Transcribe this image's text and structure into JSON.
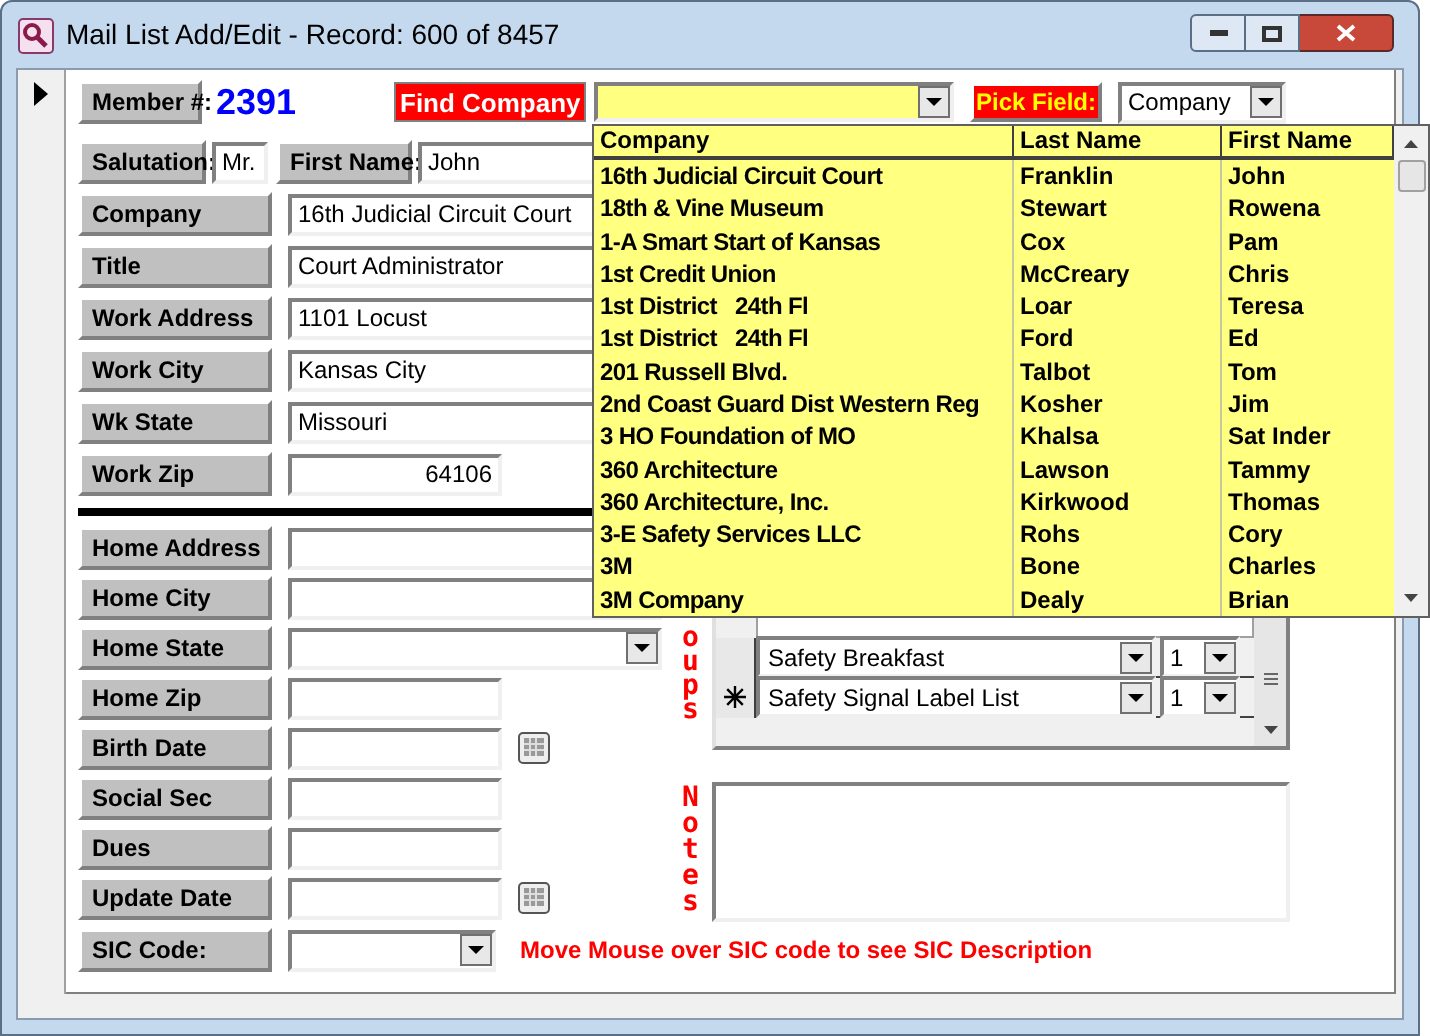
{
  "window": {
    "title": "Mail List Add/Edit - Record: 600 of 8457"
  },
  "member": {
    "label": "Member #:",
    "value": "2391"
  },
  "find_company": {
    "button": "Find Company"
  },
  "pick_field": {
    "label": "Pick Field:",
    "value": "Company"
  },
  "salutation": {
    "label": "Salutation:",
    "value": "Mr."
  },
  "first_name": {
    "label": "First Name:",
    "value": "John"
  },
  "work_fields": [
    {
      "label": "Company",
      "value": "16th Judicial Circuit Court",
      "kind": "text"
    },
    {
      "label": "Title",
      "value": "Court Administrator",
      "kind": "text"
    },
    {
      "label": "Work Address",
      "value": "1101 Locust",
      "kind": "text"
    },
    {
      "label": "Work City",
      "value": "Kansas City",
      "kind": "text"
    },
    {
      "label": "Wk State",
      "value": "Missouri",
      "kind": "text"
    },
    {
      "label": "Work Zip",
      "value": "64106",
      "kind": "number"
    }
  ],
  "home_fields": [
    {
      "label": "Home Address",
      "kind": "text"
    },
    {
      "label": "Home City",
      "kind": "text"
    },
    {
      "label": "Home State",
      "kind": "combo"
    },
    {
      "label": "Home Zip",
      "kind": "short"
    },
    {
      "label": "Birth Date",
      "kind": "date"
    },
    {
      "label": "Social Sec",
      "kind": "short"
    },
    {
      "label": "Dues",
      "kind": "short"
    },
    {
      "label": "Update Date",
      "kind": "date"
    }
  ],
  "sic": {
    "label": "SIC Code:",
    "hint": "Move Mouse over SIC code to see SIC Description"
  },
  "groups": {
    "label": "oups",
    "rows": [
      {
        "name": "Safety Breakfast",
        "count": "1",
        "new_record": false
      },
      {
        "name": "Safety Signal Label List",
        "count": "1",
        "new_record": true
      }
    ]
  },
  "notes": {
    "label": "Notes"
  },
  "dropdown": {
    "columns": [
      "Company",
      "Last Name",
      "First Name"
    ],
    "rows": [
      {
        "company": "16th Judicial Circuit Court",
        "last_name": "Franklin",
        "first_name": "John"
      },
      {
        "company": "18th & Vine Museum",
        "last_name": "Stewart",
        "first_name": "Rowena"
      },
      {
        "company": "1-A Smart Start of Kansas",
        "last_name": "Cox",
        "first_name": "Pam"
      },
      {
        "company": "1st Credit Union",
        "last_name": "McCreary",
        "first_name": "Chris"
      },
      {
        "company": "1st District   24th Fl",
        "last_name": "Loar",
        "first_name": "Teresa"
      },
      {
        "company": "1st District   24th Fl",
        "last_name": "Ford",
        "first_name": "Ed"
      },
      {
        "company": "201 Russell Blvd.",
        "last_name": "Talbot",
        "first_name": "Tom"
      },
      {
        "company": "2nd Coast Guard Dist Western Reg",
        "last_name": "Kosher",
        "first_name": "Jim"
      },
      {
        "company": "3 HO Foundation of MO",
        "last_name": "Khalsa",
        "first_name": "Sat Inder"
      },
      {
        "company": "360 Architecture",
        "last_name": "Lawson",
        "first_name": "Tammy"
      },
      {
        "company": "360 Architecture, Inc.",
        "last_name": "Kirkwood",
        "first_name": "Thomas"
      },
      {
        "company": "3-E Safety Services LLC",
        "last_name": "Rohs",
        "first_name": "Cory"
      },
      {
        "company": "3M",
        "last_name": "Bone",
        "first_name": "Charles"
      },
      {
        "company": "3M Company",
        "last_name": "Dealy",
        "first_name": "Brian"
      }
    ]
  }
}
